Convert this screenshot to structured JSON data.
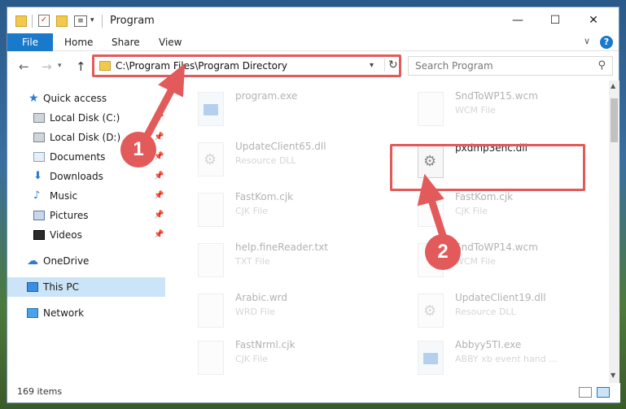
{
  "window": {
    "title": "Program",
    "controls": {
      "minimize": "—",
      "maximize": "☐",
      "close": "✕"
    }
  },
  "quick_access": {
    "dropdown": "▾",
    "check": "✓",
    "props": "≡"
  },
  "ribbon": {
    "tabs": [
      "File",
      "Home",
      "Share",
      "View"
    ],
    "expand": "∨",
    "help": "?"
  },
  "nav": {
    "back": "←",
    "forward": "→",
    "recent": "▾",
    "up": "↑",
    "address": "C:\\Program Files\\Program Directory",
    "address_drop": "▾",
    "refresh": "↻",
    "search_placeholder": "Search Program",
    "search_icon": "⚲"
  },
  "sidebar": {
    "items": [
      {
        "label": "Quick access",
        "icon": "star-icon",
        "pinned": false
      },
      {
        "label": "Local Disk (C:)",
        "icon": "disk-icon",
        "pinned": true
      },
      {
        "label": "Local Disk (D:)",
        "icon": "disk-icon",
        "pinned": true
      },
      {
        "label": "Documents",
        "icon": "documents-icon",
        "pinned": true
      },
      {
        "label": "Downloads",
        "icon": "download-icon",
        "pinned": true
      },
      {
        "label": "Music",
        "icon": "music-icon",
        "pinned": true
      },
      {
        "label": "Pictures",
        "icon": "pictures-icon",
        "pinned": true
      },
      {
        "label": "Videos",
        "icon": "videos-icon",
        "pinned": true
      },
      {
        "label": "OneDrive",
        "icon": "cloud-icon",
        "pinned": false
      },
      {
        "label": "This PC",
        "icon": "pc-icon",
        "pinned": false,
        "selected": true
      },
      {
        "label": "Network",
        "icon": "network-icon",
        "pinned": false
      }
    ],
    "pin_glyph": "📌"
  },
  "files": [
    {
      "name": "program.exe",
      "type": "",
      "kind": "exe"
    },
    {
      "name": "SndToWP15.wcm",
      "type": "WCM File",
      "kind": "doc"
    },
    {
      "name": "UpdateClient65.dll",
      "type": "Resource DLL",
      "kind": "dll"
    },
    {
      "name": "pxdmp3enc.dll",
      "type": "",
      "kind": "dll",
      "highlighted": true
    },
    {
      "name": "FastKom.cjk",
      "type": "CJK File",
      "kind": "doc"
    },
    {
      "name": "FastKom.cjk",
      "type": "CJK File",
      "kind": "doc"
    },
    {
      "name": "help.fineReader.txt",
      "type": "TXT File",
      "kind": "doc"
    },
    {
      "name": "SndToWP14.wcm",
      "type": "WCM File",
      "kind": "doc"
    },
    {
      "name": "Arabic.wrd",
      "type": "WRD File",
      "kind": "doc"
    },
    {
      "name": "UpdateClient19.dll",
      "type": "Resource DLL",
      "kind": "dll"
    },
    {
      "name": "FastNrml.cjk",
      "type": "CJK File",
      "kind": "doc"
    },
    {
      "name": "Abbyy5TI.exe",
      "type": "ABBY xb event hand ...",
      "kind": "exe"
    }
  ],
  "status": {
    "count": "169 items"
  },
  "annotations": {
    "badge1": "1",
    "badge2": "2",
    "color": "#e35a5a"
  },
  "colors": {
    "accent": "#1979ca",
    "selected": "#cce4f7",
    "annotation": "#e35a5a"
  }
}
